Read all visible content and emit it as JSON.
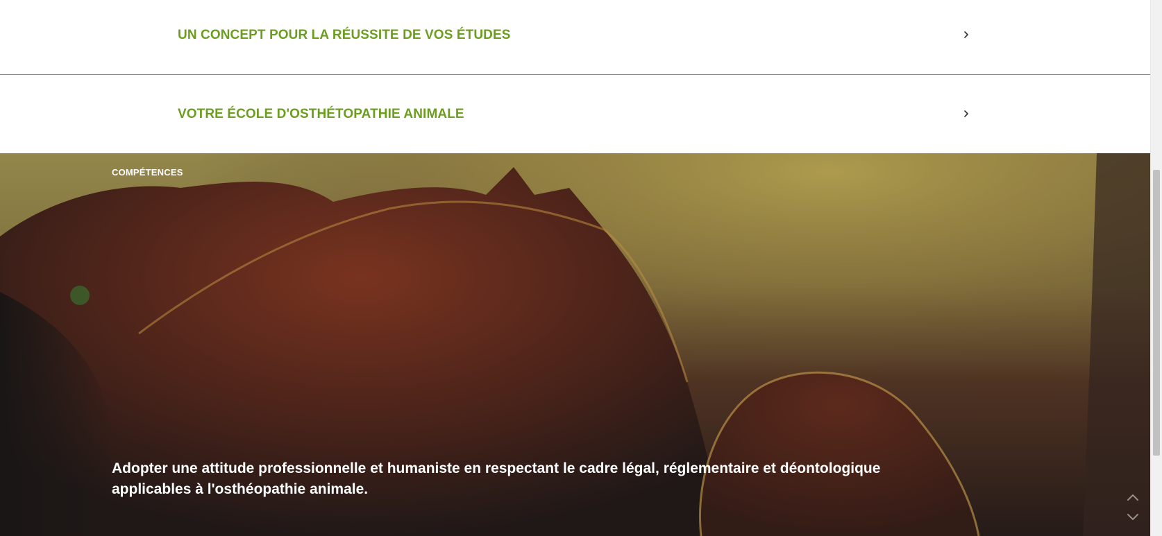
{
  "accordion": {
    "items": [
      {
        "label": "UN CONCEPT POUR LA RÉUSSITE DE VOS ÉTUDES",
        "icon": "chevron-right-icon"
      },
      {
        "label": "VOTRE ÉCOLE D'OSTHÉTOPATHIE ANIMALE",
        "icon": "chevron-right-icon"
      }
    ]
  },
  "hero": {
    "eyebrow": "COMPÉTENCES",
    "text": "Adopter une attitude professionnelle et humaniste en respectant le cadre légal, réglementaire et déontologique applicables à l'osthéopathie animale.",
    "nav": {
      "up_icon": "chevron-up-icon",
      "down_icon": "chevron-down-icon"
    }
  },
  "colors": {
    "accent_green": "#6b9e1f",
    "divider": "#8a8a8a",
    "hero_text": "#ffffff"
  }
}
